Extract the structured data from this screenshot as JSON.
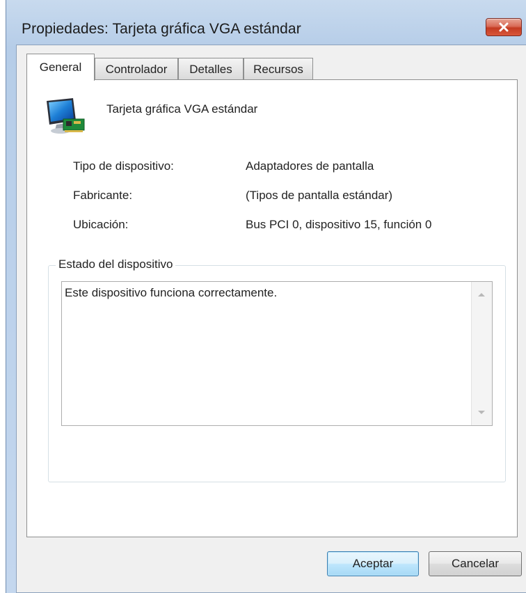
{
  "window": {
    "title": "Propiedades: Tarjeta gráfica VGA estándar",
    "close_icon": "close-icon"
  },
  "tabs": [
    {
      "label": "General",
      "active": true
    },
    {
      "label": "Controlador",
      "active": false
    },
    {
      "label": "Detalles",
      "active": false
    },
    {
      "label": "Recursos",
      "active": false
    }
  ],
  "device": {
    "icon": "display-adapter-icon",
    "name": "Tarjeta gráfica VGA estándar",
    "properties": [
      {
        "label": "Tipo de dispositivo:",
        "value": "Adaptadores de pantalla"
      },
      {
        "label": "Fabricante:",
        "value": "(Tipos de pantalla estándar)"
      },
      {
        "label": "Ubicación:",
        "value": "Bus PCI 0, dispositivo 15, función 0"
      }
    ]
  },
  "status": {
    "group_label": "Estado del dispositivo",
    "text": "Este dispositivo funciona correctamente."
  },
  "buttons": {
    "ok": "Aceptar",
    "cancel": "Cancelar"
  }
}
